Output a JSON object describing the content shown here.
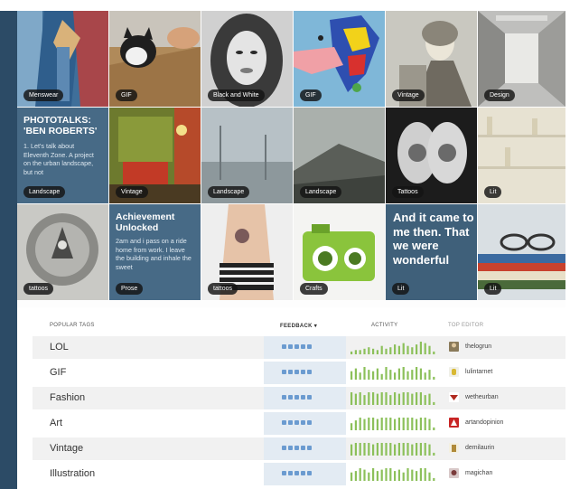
{
  "colors": {
    "frame_blue": "#2c4b66",
    "text_tile_blue": "#476a86",
    "feedback_dot": "#6b9bd0",
    "spark_green": "#8cc05a"
  },
  "tiles": [
    {
      "tag": "Menswear"
    },
    {
      "tag": "GIF"
    },
    {
      "tag": "Black and White"
    },
    {
      "tag": "GIF"
    },
    {
      "tag": "Vintage"
    },
    {
      "tag": "Design"
    },
    {
      "tag": "Landscape",
      "title": "PHOTOTALKS: 'BEN ROBERTS'",
      "subtitle": "1. Let's talk about Eleventh Zone. A project on the urban landscape, but not"
    },
    {
      "tag": "Vintage"
    },
    {
      "tag": "Landscape"
    },
    {
      "tag": "Landscape"
    },
    {
      "tag": "Tattoos"
    },
    {
      "tag": "Lit"
    },
    {
      "tag": "tattoos"
    },
    {
      "tag": "Prose",
      "title": "Achievement Unlocked",
      "subtitle": "2am and i pass on a ride home from work. I leave the building and inhale the sweet"
    },
    {
      "tag": "tattoos"
    },
    {
      "tag": "Crafts"
    },
    {
      "tag": "Lit",
      "quote": "And it came to me then. That we were wonderful"
    },
    {
      "tag": "Lit"
    }
  ],
  "table": {
    "headers": {
      "tags": "POPULAR TAGS",
      "feedback": "FEEDBACK ▾",
      "activity": "ACTIVITY",
      "editor": "TOP EDITOR"
    },
    "rows": [
      {
        "tag": "LOL",
        "editor": "thelogrun",
        "activity": [
          2,
          3,
          3,
          4,
          5,
          4,
          3,
          6,
          4,
          5,
          7,
          6,
          8,
          6,
          5,
          7,
          9,
          8,
          6,
          2
        ]
      },
      {
        "tag": "GIF",
        "editor": "lulintarnet",
        "activity": [
          6,
          8,
          5,
          9,
          7,
          6,
          8,
          4,
          9,
          7,
          5,
          8,
          9,
          6,
          7,
          9,
          8,
          5,
          7,
          2
        ]
      },
      {
        "tag": "Fashion",
        "editor": "wetheurban",
        "activity": [
          9,
          8,
          9,
          7,
          9,
          9,
          8,
          9,
          9,
          7,
          9,
          8,
          9,
          9,
          8,
          9,
          9,
          7,
          8,
          2
        ]
      },
      {
        "tag": "Art",
        "editor": "artandopinion",
        "activity": [
          5,
          7,
          9,
          8,
          9,
          9,
          8,
          9,
          9,
          9,
          8,
          9,
          9,
          9,
          9,
          8,
          9,
          9,
          8,
          2
        ]
      },
      {
        "tag": "Vintage",
        "editor": "demilaurin",
        "activity": [
          8,
          9,
          9,
          9,
          9,
          8,
          9,
          9,
          9,
          9,
          8,
          9,
          9,
          9,
          8,
          9,
          9,
          9,
          8,
          2
        ]
      },
      {
        "tag": "Illustration",
        "editor": "magichan",
        "activity": [
          6,
          7,
          9,
          8,
          6,
          9,
          7,
          8,
          9,
          9,
          7,
          8,
          6,
          9,
          8,
          7,
          9,
          9,
          6,
          2
        ]
      }
    ]
  }
}
